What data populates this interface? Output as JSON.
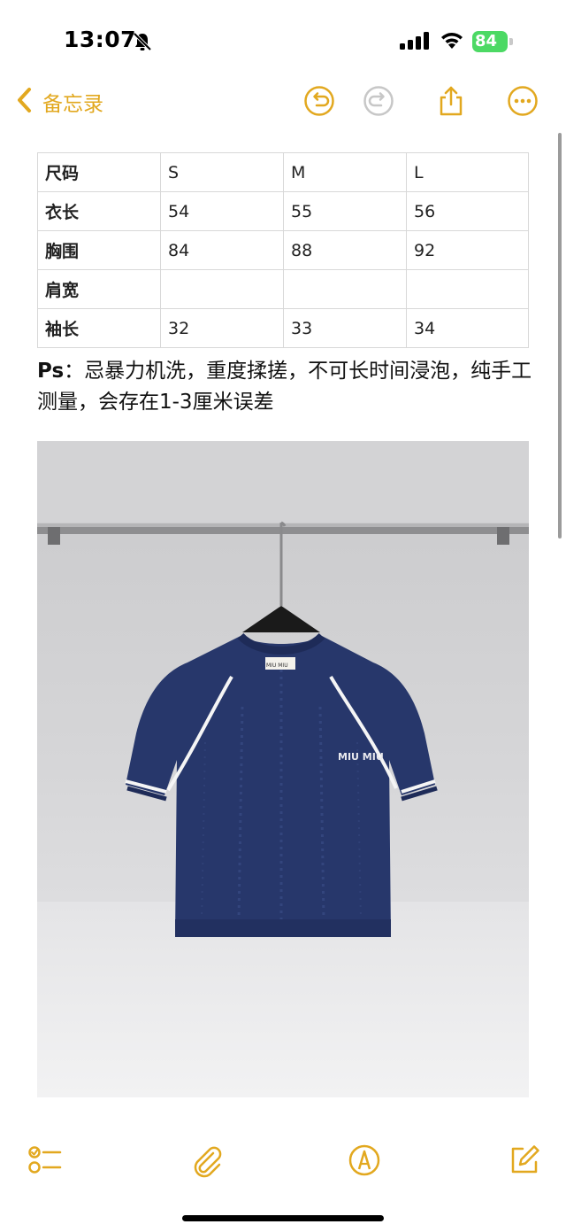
{
  "status_bar": {
    "time": "13:07",
    "battery_level": "84",
    "icons": [
      "bell-slash-icon",
      "cellular-signal-icon",
      "wifi-icon",
      "battery-charging-icon"
    ]
  },
  "nav": {
    "back_label": "备忘录",
    "accent_color": "#e2a81f",
    "icons": [
      "chevron-left-icon",
      "undo-icon",
      "redo-icon",
      "share-icon",
      "more-icon"
    ]
  },
  "size_table": {
    "rows": [
      [
        "尺码",
        "S",
        "M",
        "L"
      ],
      [
        "衣长",
        "54",
        "55",
        "56"
      ],
      [
        "胸围",
        "84",
        "88",
        "92"
      ],
      [
        "肩宽",
        "",
        "",
        ""
      ],
      [
        "袖长",
        "32",
        "33",
        "34"
      ]
    ]
  },
  "note": {
    "prefix": "Ps",
    "text": "：忌暴力机洗，重度揉搓，不可长时间浸泡，纯手工测量，会存在1-3厘米误差"
  },
  "photo": {
    "garment_color": "#27376b",
    "label_text": "MIU MIU",
    "logo_text": "MIU MIU"
  },
  "toolbar": {
    "icons": [
      "checklist-icon",
      "paperclip-icon",
      "markup-pen-icon",
      "compose-icon"
    ]
  }
}
